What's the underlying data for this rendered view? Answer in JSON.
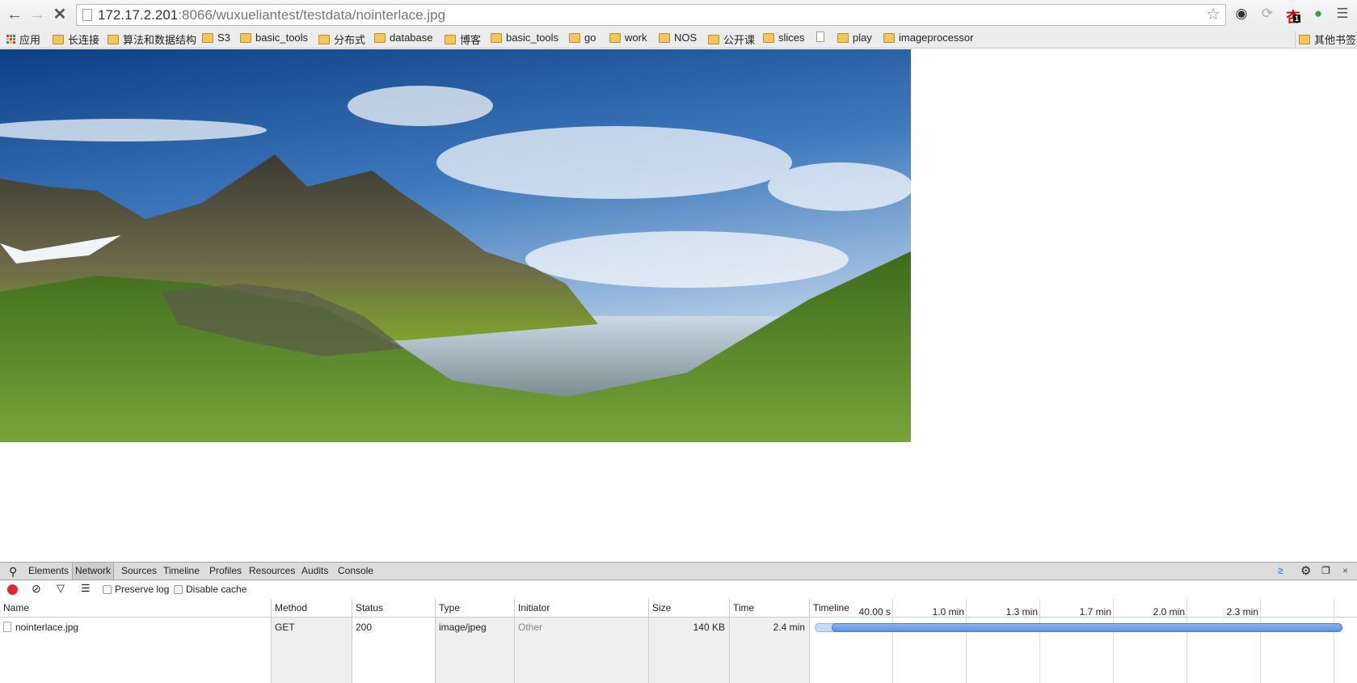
{
  "browser": {
    "url_host": "172.17.2.201",
    "url_rest": ":8066/wuxueliantest/testdata/nointerlace.jpg",
    "nav": {
      "back": "back-icon",
      "forward": "forward-icon",
      "stop": "stop-icon"
    },
    "extensions": [
      "evernote-icon",
      "sync-icon",
      "extension-icon",
      "hangouts-icon"
    ],
    "ext_badge": "1",
    "bookmarks": [
      {
        "label": "应用",
        "type": "apps"
      },
      {
        "label": "长连接",
        "type": "folder"
      },
      {
        "label": "算法和数据结构",
        "type": "folder"
      },
      {
        "label": "S3",
        "type": "folder"
      },
      {
        "label": "basic_tools",
        "type": "folder"
      },
      {
        "label": "分布式",
        "type": "folder"
      },
      {
        "label": "database",
        "type": "folder"
      },
      {
        "label": "博客",
        "type": "folder"
      },
      {
        "label": "basic_tools",
        "type": "folder"
      },
      {
        "label": "go",
        "type": "folder"
      },
      {
        "label": "work",
        "type": "folder"
      },
      {
        "label": "NOS",
        "type": "folder"
      },
      {
        "label": "公开课",
        "type": "folder"
      },
      {
        "label": "slices",
        "type": "folder"
      },
      {
        "label": "",
        "type": "file"
      },
      {
        "label": "play",
        "type": "folder"
      },
      {
        "label": "imageprocessor",
        "type": "folder"
      }
    ],
    "other_bookmarks": "其他书签"
  },
  "devtools": {
    "tabs": [
      "Elements",
      "Network",
      "Sources",
      "Timeline",
      "Profiles",
      "Resources",
      "Audits",
      "Console"
    ],
    "active_tab": "Network",
    "preserve_log": "Preserve log",
    "disable_cache": "Disable cache",
    "columns": [
      "Name",
      "Method",
      "Status",
      "Type",
      "Initiator",
      "Size",
      "Time",
      "Timeline"
    ],
    "row": {
      "name": "nointerlace.jpg",
      "method": "GET",
      "status": "200",
      "type": "image/jpeg",
      "initiator": "Other",
      "size": "140 KB",
      "time": "2.4 min"
    },
    "timeline_ticks": [
      "40.00 s",
      "1.0 min",
      "1.3 min",
      "1.7 min",
      "2.0 min",
      "2.3 min"
    ],
    "colors": {
      "record": "#e0282e",
      "bar": "#6f9ee8",
      "accent": "#4d8ee6"
    }
  }
}
